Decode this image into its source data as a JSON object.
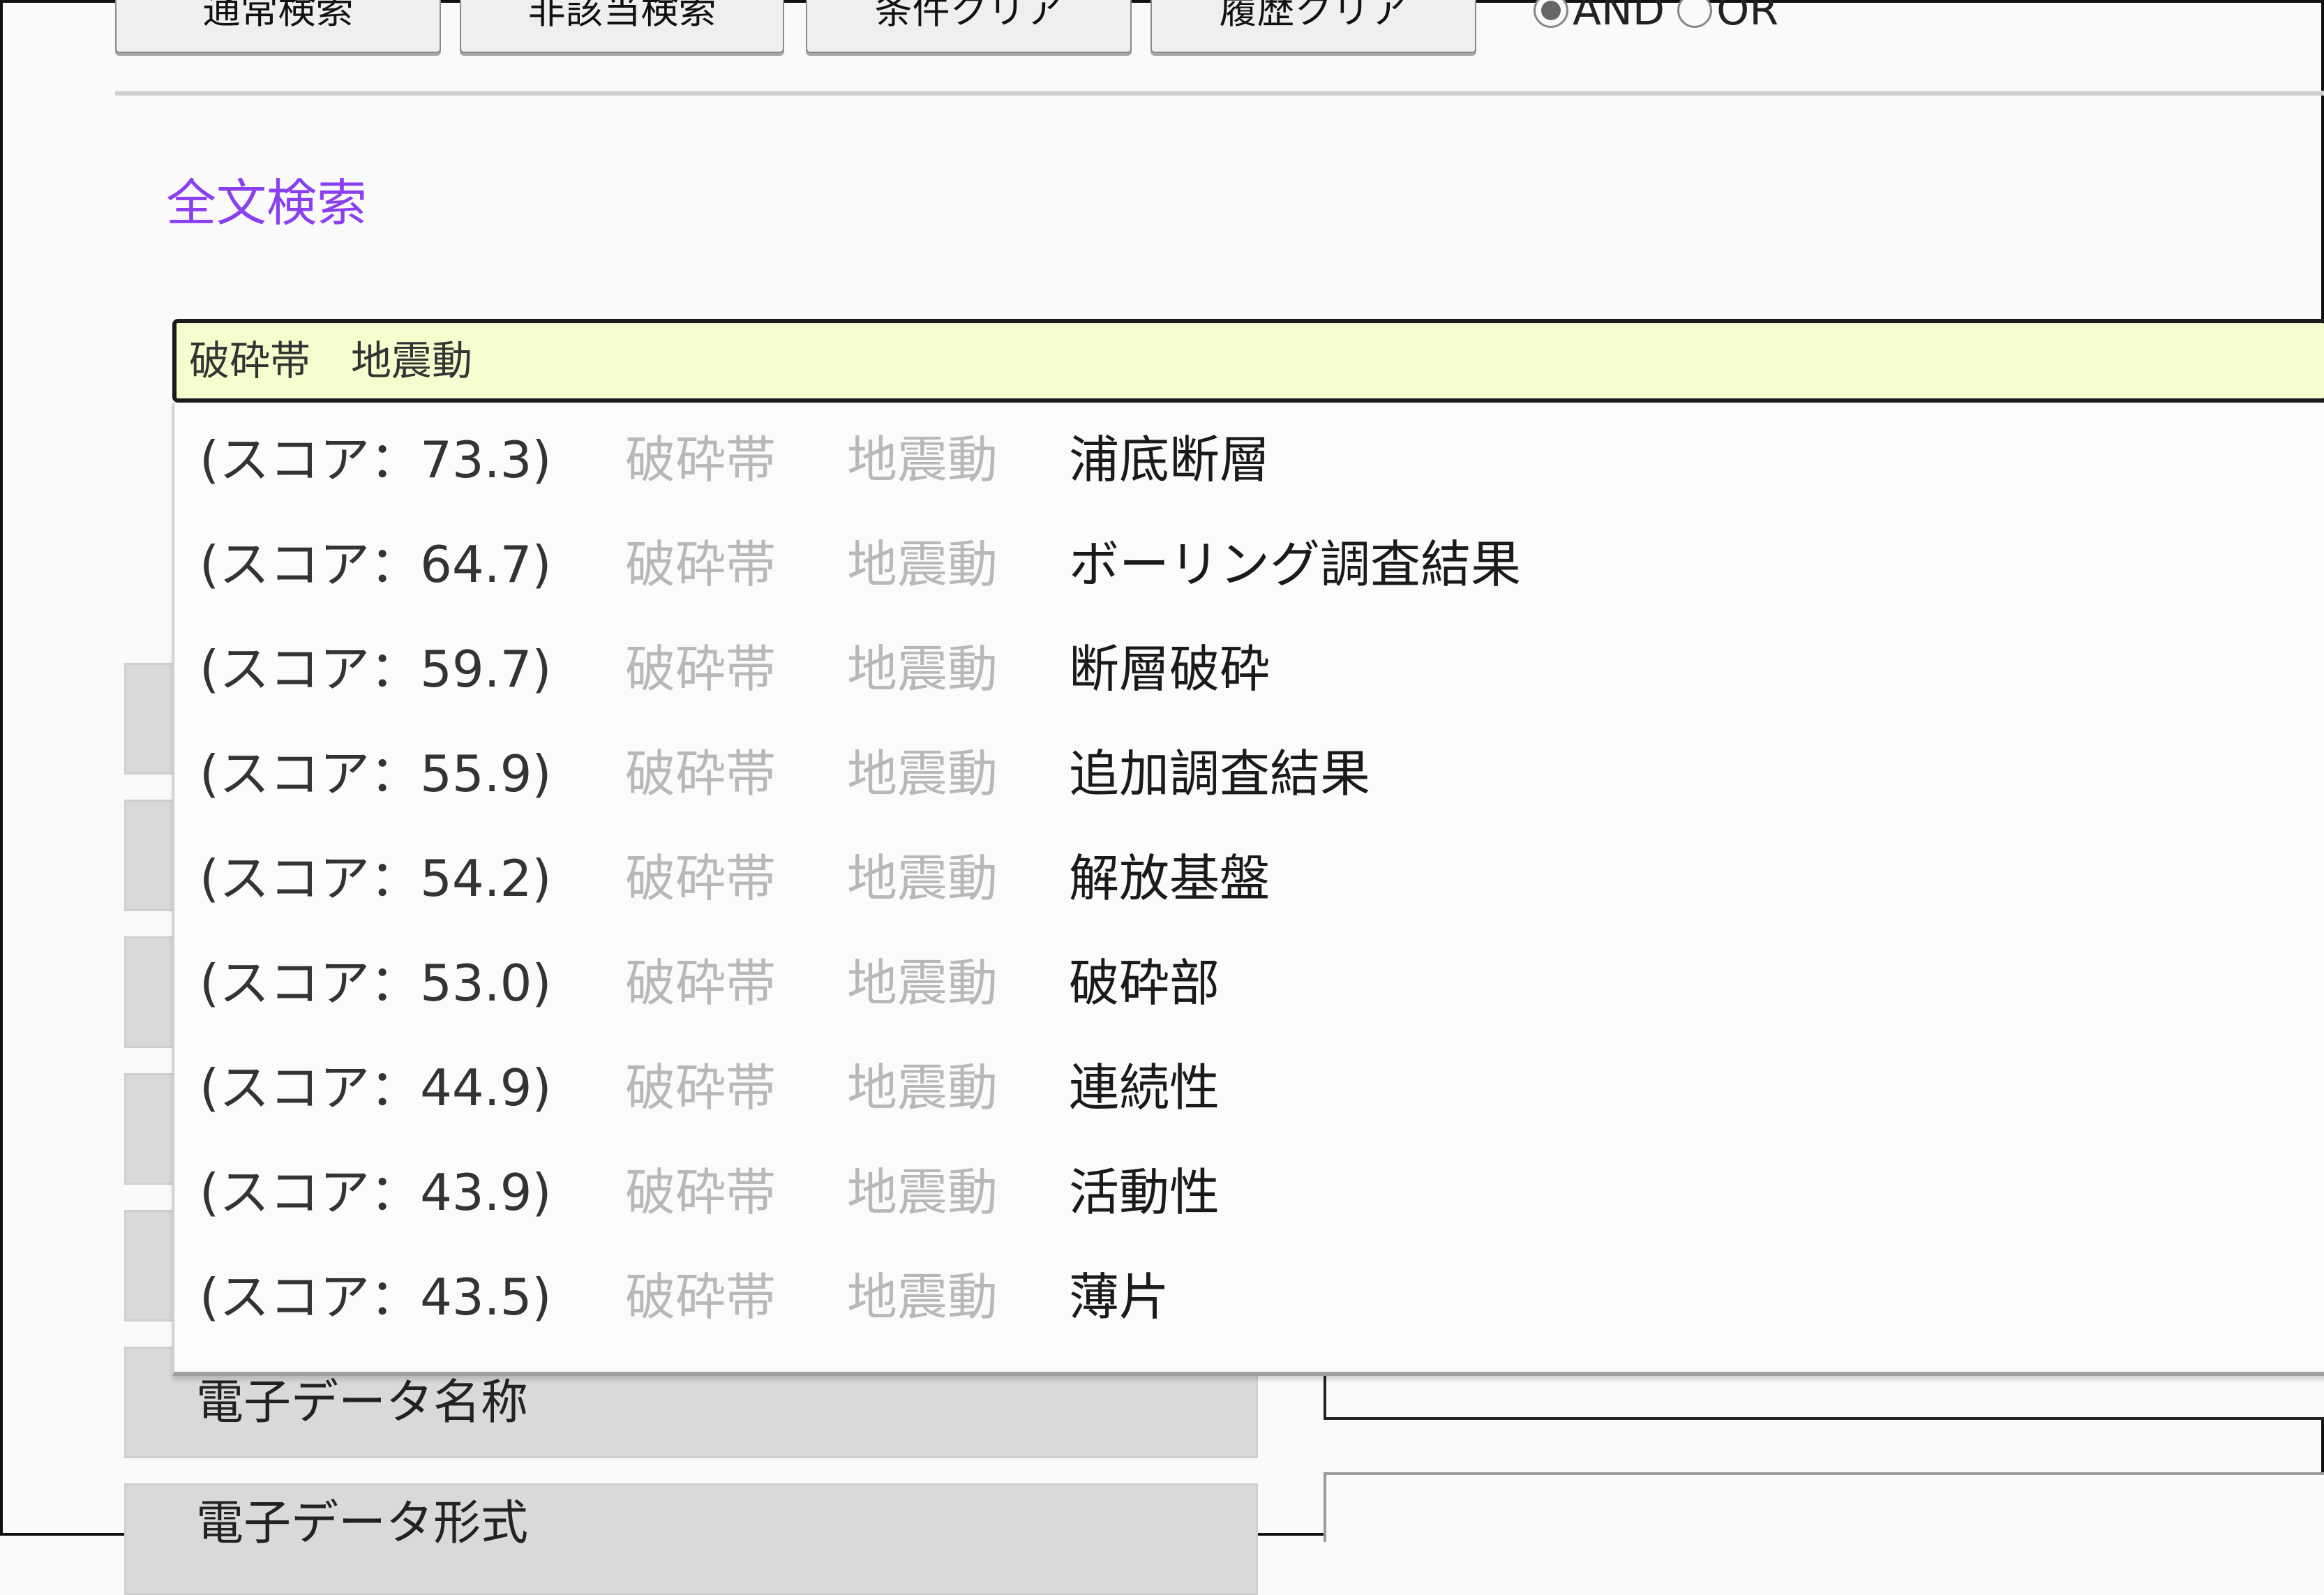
{
  "toolbar": {
    "buttons": [
      {
        "label": "通常検索"
      },
      {
        "label": "非該当検索"
      },
      {
        "label": "条件クリア"
      },
      {
        "label": "履歴クリア"
      }
    ],
    "logic": {
      "options": [
        {
          "label": "AND",
          "checked": true
        },
        {
          "label": "OR",
          "checked": false
        }
      ]
    }
  },
  "fulltext": {
    "title": "全文検索",
    "query": "破砕帯　地震動",
    "accent_color": "#8a3ff0",
    "input_bg": "#f7fccf"
  },
  "suggestions": [
    {
      "score": "(スコア：73.3)",
      "term1": "破砕帯",
      "term2": "地震動",
      "result": "浦底断層"
    },
    {
      "score": "(スコア：64.7)",
      "term1": "破砕帯",
      "term2": "地震動",
      "result": "ボーリング調査結果"
    },
    {
      "score": "(スコア：59.7)",
      "term1": "破砕帯",
      "term2": "地震動",
      "result": "断層破砕"
    },
    {
      "score": "(スコア：55.9)",
      "term1": "破砕帯",
      "term2": "地震動",
      "result": "追加調査結果"
    },
    {
      "score": "(スコア：54.2)",
      "term1": "破砕帯",
      "term2": "地震動",
      "result": "解放基盤"
    },
    {
      "score": "(スコア：53.0)",
      "term1": "破砕帯",
      "term2": "地震動",
      "result": "破砕部"
    },
    {
      "score": "(スコア：44.9)",
      "term1": "破砕帯",
      "term2": "地震動",
      "result": "連続性"
    },
    {
      "score": "(スコア：43.9)",
      "term1": "破砕帯",
      "term2": "地震動",
      "result": "活動性"
    },
    {
      "score": "(スコア：43.5)",
      "term1": "破砕帯",
      "term2": "地震動",
      "result": "薄片"
    }
  ],
  "fields": [
    {
      "label": ""
    },
    {
      "label": ""
    },
    {
      "label": ""
    },
    {
      "label": ""
    },
    {
      "label": ""
    },
    {
      "label": "電子データ名称"
    },
    {
      "label": "電子データ形式"
    }
  ]
}
